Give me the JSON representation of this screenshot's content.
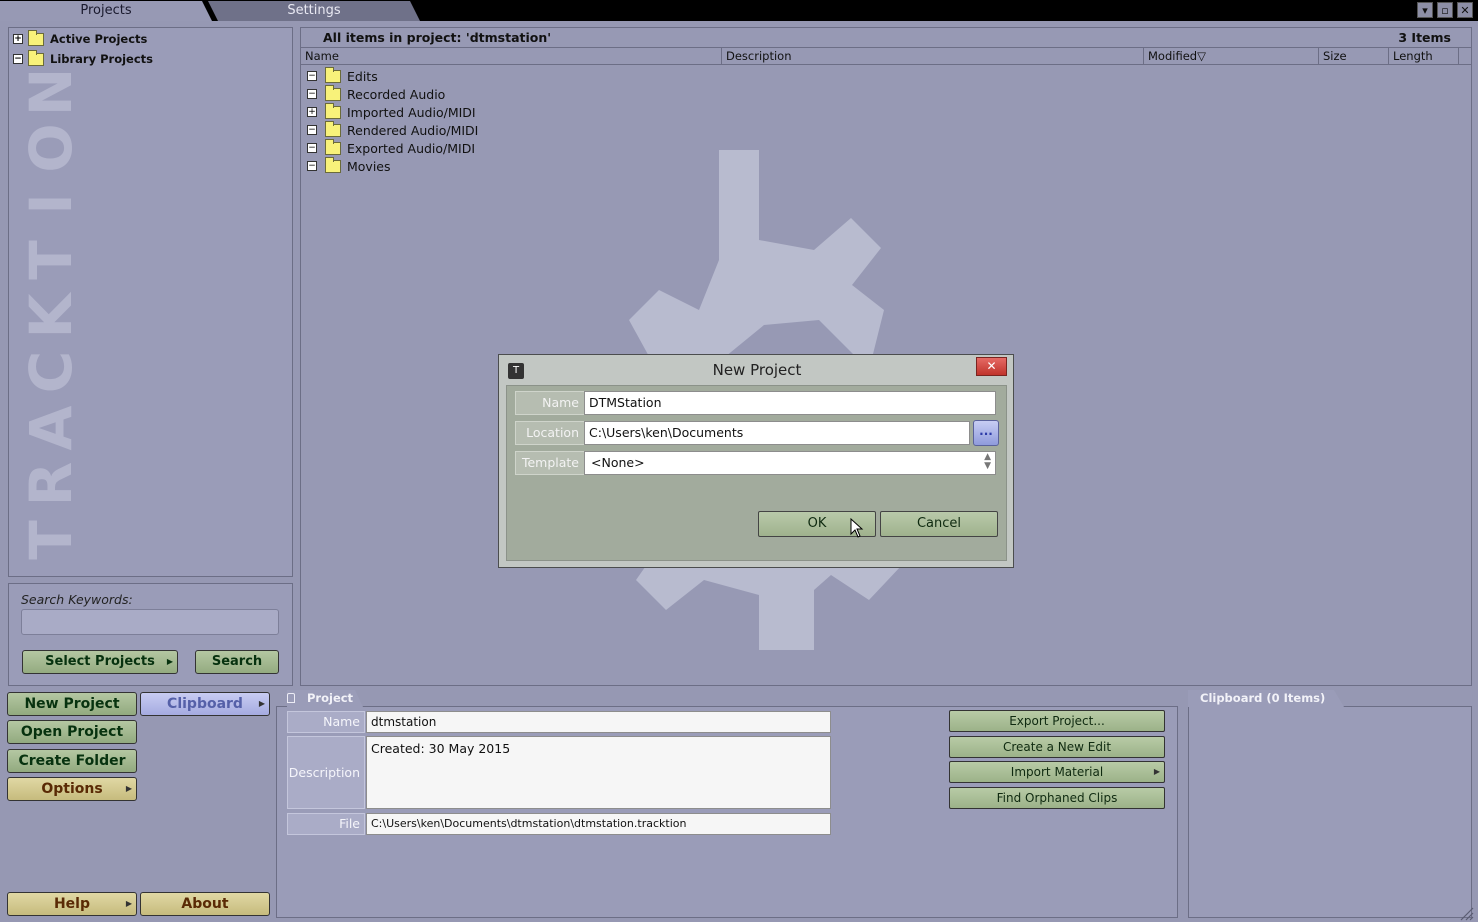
{
  "tabs": {
    "projects": "Projects",
    "settings": "Settings"
  },
  "window_controls": {
    "minimize": "▾",
    "maximize": "▫",
    "close": "✕"
  },
  "watermark": "TRACKTION",
  "tree": [
    {
      "label": "Active Projects",
      "expander": "+"
    },
    {
      "label": "Library Projects",
      "expander": "−"
    }
  ],
  "search": {
    "label": "Search Keywords:",
    "value": "",
    "select_projects": "Select Projects",
    "search_button": "Search"
  },
  "list": {
    "title": "All items in project: 'dtmstation'",
    "count": "3 Items",
    "columns": [
      "Name",
      "Description",
      "Modified▽",
      "Size",
      "Length"
    ],
    "rows": [
      {
        "label": "Edits",
        "expander": "−"
      },
      {
        "label": "Recorded Audio",
        "expander": "−"
      },
      {
        "label": "Imported Audio/MIDI",
        "expander": "+"
      },
      {
        "label": "Rendered Audio/MIDI",
        "expander": "−"
      },
      {
        "label": "Exported Audio/MIDI",
        "expander": "−"
      },
      {
        "label": "Movies",
        "expander": "−"
      }
    ]
  },
  "dialog": {
    "title": "New Project",
    "close": "✕",
    "logo": "T",
    "fields": {
      "name_label": "Name",
      "name_value": "DTMStation",
      "location_label": "Location",
      "location_value": "C:\\Users\\ken\\Documents",
      "browse": "...",
      "template_label": "Template",
      "template_value": "<None>"
    },
    "ok": "OK",
    "cancel": "Cancel"
  },
  "left_buttons": {
    "new_project": "New Project",
    "clipboard": "Clipboard",
    "open_project": "Open Project",
    "create_folder": "Create Folder",
    "options": "Options",
    "help": "Help",
    "about": "About"
  },
  "project_panel": {
    "tab": "Project",
    "name_label": "Name",
    "name_value": "dtmstation",
    "description_label": "Description",
    "description_value": "Created: 30 May 2015",
    "file_label": "File",
    "file_value": "C:\\Users\\ken\\Documents\\dtmstation\\dtmstation.tracktion",
    "buttons": [
      "Export Project...",
      "Create a New Edit",
      "Import Material",
      "Find Orphaned Clips"
    ]
  },
  "clipboard_panel": {
    "tab": "Clipboard (0 Items)"
  }
}
